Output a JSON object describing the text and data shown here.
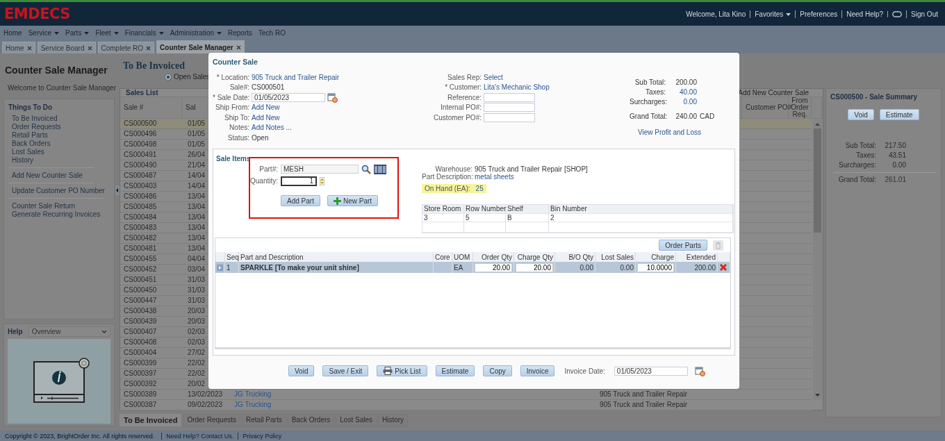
{
  "header": {
    "logo": "EMDECS",
    "links": [
      {
        "kind": "text",
        "label": "Welcome, Lita Kino"
      },
      {
        "kind": "menu",
        "label": "Favorites"
      },
      {
        "kind": "link",
        "label": "Preferences"
      },
      {
        "kind": "link",
        "label": "Need Help?"
      },
      {
        "kind": "chat"
      },
      {
        "kind": "link",
        "label": "Sign Out"
      }
    ]
  },
  "nav": [
    {
      "label": "Home",
      "has_menu": false
    },
    {
      "label": "Service",
      "has_menu": true
    },
    {
      "label": "Parts",
      "has_menu": true
    },
    {
      "label": "Fleet",
      "has_menu": true
    },
    {
      "label": "Financials",
      "has_menu": true
    },
    {
      "label": "Administration",
      "has_menu": true
    },
    {
      "label": "Reports",
      "has_menu": false
    },
    {
      "label": "Tech RO",
      "has_menu": false
    }
  ],
  "tabs": [
    {
      "label": "Home",
      "selected": false
    },
    {
      "label": "Service Board",
      "selected": false
    },
    {
      "label": "Complete RO",
      "selected": false
    },
    {
      "label": "Counter Sale Manager",
      "selected": true
    }
  ],
  "left_panel": {
    "title": "Counter Sale Manager",
    "welcome": "Welcome to Counter Sale Manager",
    "todo": {
      "title": "Things To Do",
      "groups": [
        [
          "To Be Invoiced",
          "Order Requests",
          "Retail Parts",
          "Back Orders",
          "Lost Sales",
          "History"
        ],
        [
          "Add New Counter Sale"
        ],
        [
          "Update Customer PO Number"
        ],
        [
          "Counter Sale Return",
          "Generate Recurring Invoices"
        ]
      ]
    },
    "help": {
      "title": "Help",
      "topic": "Overview"
    }
  },
  "sales_panel": {
    "title": "To Be Invoiced",
    "filter": {
      "label": "Open Sales",
      "selected": true
    },
    "list_title": "Sales List",
    "add_link": "Add New Counter Sale",
    "columns": {
      "sale_no": "Sale #",
      "column_2": "Sal",
      "customer_po": "Customer PO#",
      "from_order_req": "From Order Req."
    },
    "rows": [
      {
        "sale_no": "CS000500",
        "column_2": "01/05",
        "selected": true
      },
      {
        "sale_no": "CS000496",
        "column_2": "01/05",
        "selected": false
      },
      {
        "sale_no": "CS000498",
        "column_2": "01/05",
        "selected": false
      },
      {
        "sale_no": "CS000491",
        "column_2": "26/04",
        "selected": false
      },
      {
        "sale_no": "CS000490",
        "column_2": "21/04",
        "selected": false
      },
      {
        "sale_no": "CS000487",
        "column_2": "14/04",
        "selected": false
      },
      {
        "sale_no": "CS000403",
        "column_2": "14/04",
        "selected": false
      },
      {
        "sale_no": "CS000486",
        "column_2": "13/04",
        "selected": false
      },
      {
        "sale_no": "CS000485",
        "column_2": "13/04",
        "selected": false
      },
      {
        "sale_no": "CS000484",
        "column_2": "13/04",
        "selected": false
      },
      {
        "sale_no": "CS000483",
        "column_2": "13/04",
        "selected": false
      },
      {
        "sale_no": "CS000482",
        "column_2": "13/04",
        "selected": false
      },
      {
        "sale_no": "CS000481",
        "column_2": "13/04",
        "selected": false
      },
      {
        "sale_no": "CS000455",
        "column_2": "04/04",
        "selected": false
      },
      {
        "sale_no": "CS000452",
        "column_2": "03/04",
        "selected": false
      },
      {
        "sale_no": "CS000451",
        "column_2": "31/03",
        "selected": false
      },
      {
        "sale_no": "CS000450",
        "column_2": "31/03",
        "selected": false
      },
      {
        "sale_no": "CS000447",
        "column_2": "31/03",
        "selected": false
      },
      {
        "sale_no": "CS000438",
        "column_2": "20/03",
        "selected": false
      },
      {
        "sale_no": "CS000439",
        "column_2": "20/03",
        "selected": false
      },
      {
        "sale_no": "CS000407",
        "column_2": "02/03",
        "selected": false
      },
      {
        "sale_no": "CS000408",
        "column_2": "02/03",
        "selected": false
      },
      {
        "sale_no": "CS000404",
        "column_2": "27/02",
        "selected": false
      },
      {
        "sale_no": "CS000399",
        "column_2": "22/02",
        "selected": false
      },
      {
        "sale_no": "CS000397",
        "column_2": "22/02",
        "selected": false
      },
      {
        "sale_no": "CS000392",
        "column_2": "20/02",
        "selected": false
      },
      {
        "sale_no": "CS000389",
        "column_2": "13/02/2023",
        "column_3": "JG Trucking",
        "column_4": "905 Truck and Trailer Repair",
        "selected": false
      },
      {
        "sale_no": "CS000387",
        "column_2": "09/02/2023",
        "column_3": "JG Trucking",
        "column_4": "905 Truck and Trailer Repair",
        "selected": false
      }
    ]
  },
  "bottom_tabs": [
    {
      "label": "To Be Invoiced",
      "selected": true
    },
    {
      "label": "Order Requests",
      "selected": false
    },
    {
      "label": "Retail Parts",
      "selected": false
    },
    {
      "label": "Back Orders",
      "selected": false
    },
    {
      "label": "Lost Sales",
      "selected": false
    },
    {
      "label": "History",
      "selected": false
    }
  ],
  "summary": {
    "title": "CS000500 - Sale Summary",
    "buttons": [
      "Void",
      "Estimate"
    ],
    "totals": [
      {
        "label": "Sub Total:",
        "value": "217.50",
        "kind": "plain"
      },
      {
        "label": "Taxes:",
        "value": "43.51",
        "kind": "plain"
      },
      {
        "label": "Surcharges:",
        "value": "0.00",
        "kind": "plain"
      },
      {
        "label": "Grand Total:",
        "value": "261.01",
        "kind": "grand"
      }
    ]
  },
  "footer": {
    "copyright": "Copyright © 2023, BrightOrder Inc. All rights reserved.",
    "links": [
      "Need Help? Contact Us.",
      "Privacy Policy"
    ]
  },
  "dialog": {
    "title": "Counter Sale",
    "fields_left": [
      {
        "label": "* Location:",
        "kind": "link",
        "value": "905 Truck and Trailer Repair"
      },
      {
        "label": "Sale#:",
        "kind": "text",
        "value": "CS000501"
      },
      {
        "label": "* Sale Date:",
        "kind": "date",
        "value": "01/05/2023"
      },
      {
        "label": "Ship From:",
        "kind": "link",
        "value": "Add New"
      },
      {
        "label": "Ship To:",
        "kind": "link",
        "value": "Add New"
      },
      {
        "label": "Notes:",
        "kind": "link",
        "value": "Add Notes ..."
      },
      {
        "label": "Status:",
        "kind": "text",
        "value": "Open"
      }
    ],
    "fields_middle": [
      {
        "label": "Sales Rep:",
        "kind": "link",
        "value": "Select"
      },
      {
        "label": "* Customer:",
        "kind": "link",
        "value": "Lita's Mechanic Shop"
      },
      {
        "label": "Reference:",
        "kind": "input"
      },
      {
        "label": "Internal PO#:",
        "kind": "input"
      },
      {
        "label": "Customer PO#:",
        "kind": "input"
      }
    ],
    "totals": [
      {
        "label": "Sub Total:",
        "value": "200.00",
        "kind": "plain"
      },
      {
        "label": "Taxes:",
        "value": "40.00",
        "kind": "link"
      },
      {
        "label": "Surcharges:",
        "value": "0.00",
        "kind": "link"
      },
      {
        "label": "Grand Total:",
        "value": "240.00",
        "currency": "CAD",
        "kind": "grand"
      }
    ],
    "profit_link": "View Profit and Loss",
    "sale_items": {
      "title": "Sale Items",
      "part_label": "Part#:",
      "part_value": "MESH",
      "quantity_label": "Quantity:",
      "quantity_value": "1",
      "buttons": [
        {
          "label": "Add Part",
          "kind": "plain"
        },
        {
          "label": "New Part",
          "kind": "add"
        }
      ],
      "info": [
        {
          "label": "Warehouse:",
          "value": "905 Truck and Trailer Repair [SHOP]",
          "kind": "text"
        },
        {
          "label": "Part Description:",
          "value": "metal sheets",
          "kind": "link"
        },
        {
          "label": "On Hand (EA):",
          "value": "25",
          "kind": "highlight"
        }
      ],
      "location_table": {
        "columns": [
          "Store Room",
          "Row Number",
          "Shelf",
          "Bin Number"
        ],
        "rows": [
          [
            "3",
            "5",
            "B",
            "2"
          ]
        ]
      },
      "order_button": "Order Parts",
      "trash_disabled": true,
      "grid": {
        "columns": [
          "Seq",
          "Part and Description",
          "Core",
          "UOM",
          "Order Qty",
          "Charge Qty",
          "B/O Qty",
          "Lost Sales",
          "Charge",
          "Extended"
        ],
        "rows": [
          {
            "selected": true,
            "seq": "1",
            "part": "SPARKLE [To make your unit shine]",
            "uom": "EA",
            "order_qty": "20.00",
            "charge_qty": "20.00",
            "bo_qty": "0.00",
            "lost_sales": "0.00",
            "charge": "10.0000",
            "extended": "200.00"
          }
        ]
      }
    },
    "actions": [
      {
        "label": "Void",
        "kind": "plain"
      },
      {
        "label": "Save / Exit",
        "kind": "plain"
      },
      {
        "label": "Pick List",
        "kind": "print"
      },
      {
        "label": "Estimate",
        "kind": "plain"
      },
      {
        "label": "Copy",
        "kind": "plain"
      },
      {
        "label": "Invoice",
        "kind": "plain"
      }
    ],
    "invoice_date": {
      "label": "Invoice Date:",
      "value": "01/05/2023"
    }
  }
}
